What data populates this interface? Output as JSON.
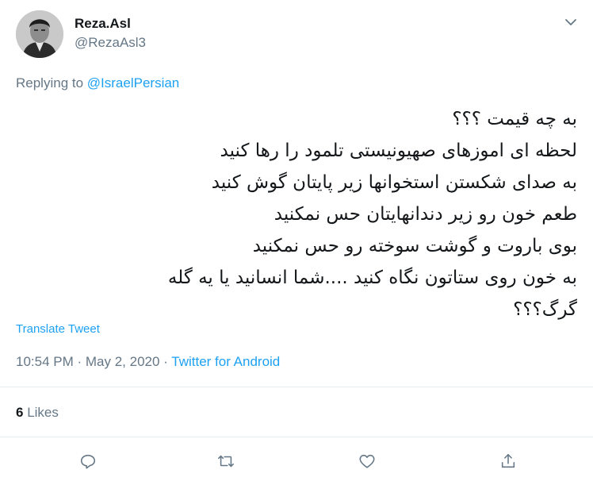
{
  "user": {
    "display_name": "Reza.Asl",
    "handle": "@RezaAsl3"
  },
  "reply": {
    "prefix": "Replying to ",
    "mention": "@IsraelPersian"
  },
  "tweet": {
    "lines": [
      "به چه قیمت ؟؟؟",
      "لحظه ای اموزهای صهیونیستی تلمود را رها کنید",
      "به صدای شکستن استخوانها زیر پایتان گوش کنید",
      "طعم خون رو زیر دندانهایتان حس نمکنید",
      "بوی باروت و گوشت سوخته رو حس نمکنید",
      "به خون روی ستاتون نگاه کنید ....شما انسانید یا یه گله",
      "گرگ؟؟؟"
    ],
    "translate_label": "Translate Tweet",
    "time": "10:54 PM",
    "separator1": " · ",
    "date": "May 2, 2020",
    "separator2": " · ",
    "source": "Twitter for Android"
  },
  "stats": {
    "likes_count": "6",
    "likes_label": " Likes"
  },
  "icons": {
    "caret": "chevron-down-icon",
    "reply": "reply-icon",
    "retweet": "retweet-icon",
    "like": "heart-icon",
    "share": "share-icon"
  },
  "colors": {
    "link": "#1da1f2",
    "secondary_text": "#657786",
    "primary_text": "#14171a",
    "divider": "#e6ecf0"
  }
}
